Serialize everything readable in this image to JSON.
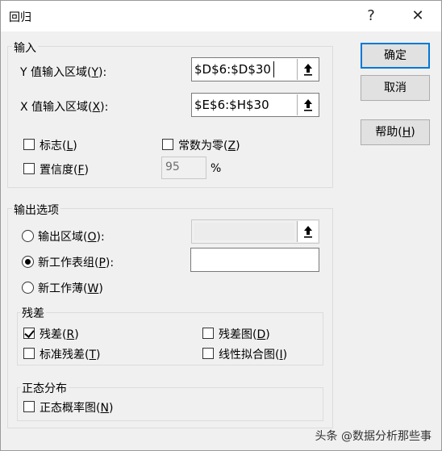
{
  "window": {
    "title": "回归",
    "help_glyph": "?",
    "close_glyph": "✕"
  },
  "input_group": {
    "label": "输入",
    "y_range": {
      "label": "Y 值输入区域(",
      "key": "Y",
      "suffix": "):",
      "value": "$D$6:$D$30"
    },
    "x_range": {
      "label": "X 值输入区域(",
      "key": "X",
      "suffix": "):",
      "value": "$E$6:$H$30"
    },
    "labels_cb": {
      "label": "标志(",
      "key": "L",
      "suffix": ")",
      "checked": false
    },
    "const_zero_cb": {
      "label": "常数为零(",
      "key": "Z",
      "suffix": ")",
      "checked": false
    },
    "confidence_cb": {
      "label": "置信度(",
      "key": "F",
      "suffix": ")",
      "checked": false
    },
    "confidence_value": "95",
    "percent": "%"
  },
  "buttons": {
    "ok": "确定",
    "cancel": "取消",
    "help": {
      "label": "帮助(",
      "key": "H",
      "suffix": ")"
    }
  },
  "output_group": {
    "label": "输出选项",
    "output_range": {
      "label": "输出区域(",
      "key": "O",
      "suffix": "):",
      "selected": false,
      "value": ""
    },
    "new_sheet": {
      "label": "新工作表组(",
      "key": "P",
      "suffix": "):",
      "selected": true,
      "value": ""
    },
    "new_workbook": {
      "label": "新工作薄(",
      "key": "W",
      "suffix": ")",
      "selected": false
    }
  },
  "residuals_group": {
    "label": "残差",
    "residuals": {
      "label": "残差(",
      "key": "R",
      "suffix": ")",
      "checked": true
    },
    "residual_plots": {
      "label": "残差图(",
      "key": "D",
      "suffix": ")",
      "checked": false
    },
    "std_residuals": {
      "label": "标准残差(",
      "key": "T",
      "suffix": ")",
      "checked": false
    },
    "line_fit": {
      "label": "线性拟合图(",
      "key": "I",
      "suffix": ")",
      "checked": false
    }
  },
  "normal_group": {
    "label": "正态分布",
    "normal_plot": {
      "label": "正态概率图(",
      "key": "N",
      "suffix": ")",
      "checked": false
    }
  },
  "watermark": "头条 @数据分析那些事"
}
